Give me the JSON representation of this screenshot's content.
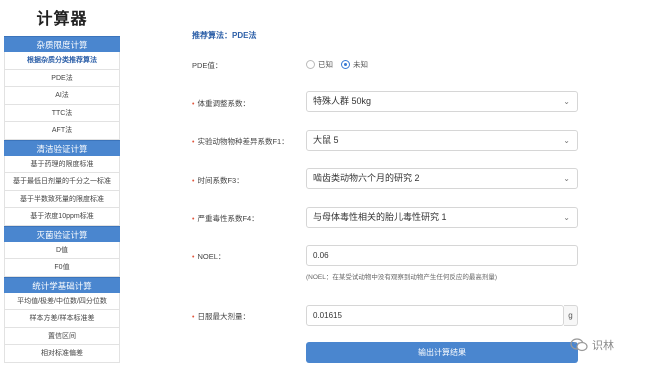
{
  "app_title": "计算器",
  "sidebar": {
    "sections": [
      {
        "header": "杂质限度计算",
        "items": [
          {
            "label": "根据杂质分类推荐算法",
            "active": true
          },
          {
            "label": "PDE法",
            "active": false
          },
          {
            "label": "AI法",
            "active": false
          },
          {
            "label": "TTC法",
            "active": false
          },
          {
            "label": "AFT法",
            "active": false
          }
        ]
      },
      {
        "header": "清洁验证计算",
        "items": [
          {
            "label": "基于药理的限度标准",
            "active": false
          },
          {
            "label": "基于最低日剂量的千分之一标准",
            "active": false
          },
          {
            "label": "基于半数致死量的限度标准",
            "active": false
          },
          {
            "label": "基于浓度10ppm标准",
            "active": false
          }
        ]
      },
      {
        "header": "灭菌验证计算",
        "items": [
          {
            "label": "D值",
            "active": false
          },
          {
            "label": "F0值",
            "active": false
          }
        ]
      },
      {
        "header": "统计学基础计算",
        "items": [
          {
            "label": "平均值/极差/中位数/四分位数",
            "active": false
          },
          {
            "label": "样本方差/样本标准差",
            "active": false
          },
          {
            "label": "置信区间",
            "active": false
          },
          {
            "label": "相对标准偏差",
            "active": false
          }
        ]
      }
    ]
  },
  "main": {
    "algo_title": "推荐算法：PDE法",
    "pde_label": "PDE值：",
    "pde_options": [
      "已知",
      "未知"
    ],
    "pde_selected": "未知",
    "fields": {
      "f1": {
        "label": "体重调整系数：",
        "value": "特殊人群 50kg"
      },
      "f2": {
        "label": "实验动物物种差异系数F1：",
        "value": "大鼠 5"
      },
      "f3": {
        "label": "时间系数F3：",
        "value": "啮齿类动物六个月的研究 2"
      },
      "f4": {
        "label": "严重毒性系数F4：",
        "value": "与母体毒性相关的胎儿毒性研究 1"
      },
      "noel": {
        "label": "NOEL：",
        "value": "0.06"
      },
      "daily": {
        "label": "日服最大剂量：",
        "value": "0.01615",
        "unit": "g"
      }
    },
    "noel_note": "(NOEL：在某受试动物中没有观察到动物产生任何反应的最高剂量)",
    "submit_label": "输出计算结果"
  },
  "watermark": "识林"
}
